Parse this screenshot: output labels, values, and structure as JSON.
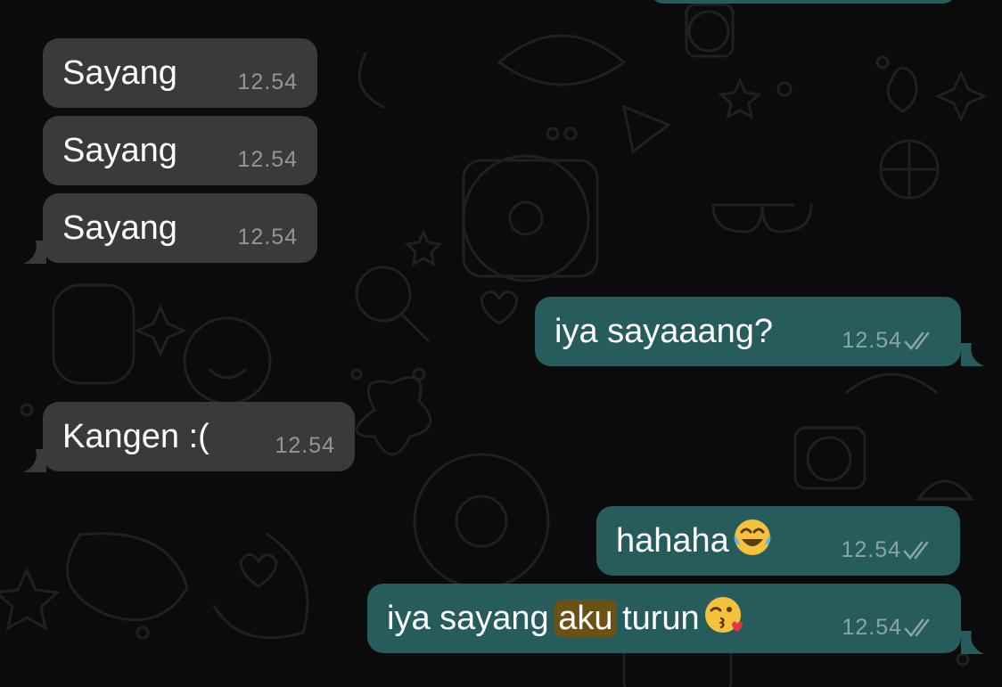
{
  "chat": {
    "messages": [
      {
        "direction": "incoming",
        "text": "Sayang",
        "time": "12.54"
      },
      {
        "direction": "incoming",
        "text": "Sayang",
        "time": "12.54"
      },
      {
        "direction": "incoming",
        "text": "Sayang",
        "time": "12.54"
      },
      {
        "direction": "outgoing",
        "text": "iya sayaaang?",
        "time": "12.54",
        "status": "double-check-read-icon"
      },
      {
        "direction": "incoming",
        "text": "Kangen :(",
        "time": "12.54"
      },
      {
        "direction": "outgoing",
        "text": "hahaha",
        "emoji": "tears-of-joy-emoji",
        "time": "12.54",
        "status": "double-check-read-icon"
      },
      {
        "direction": "outgoing",
        "text_before": "iya sayang ",
        "highlight": "aku",
        "text_after": " turun",
        "emoji": "kissing-wink-emoji",
        "time": "12.54",
        "status": "double-check-read-icon"
      }
    ]
  },
  "colors": {
    "background": "#0b0b0b",
    "incoming_bubble": "#3a3a3c",
    "outgoing_bubble": "#265d5c",
    "search_highlight": "#6b5214"
  }
}
